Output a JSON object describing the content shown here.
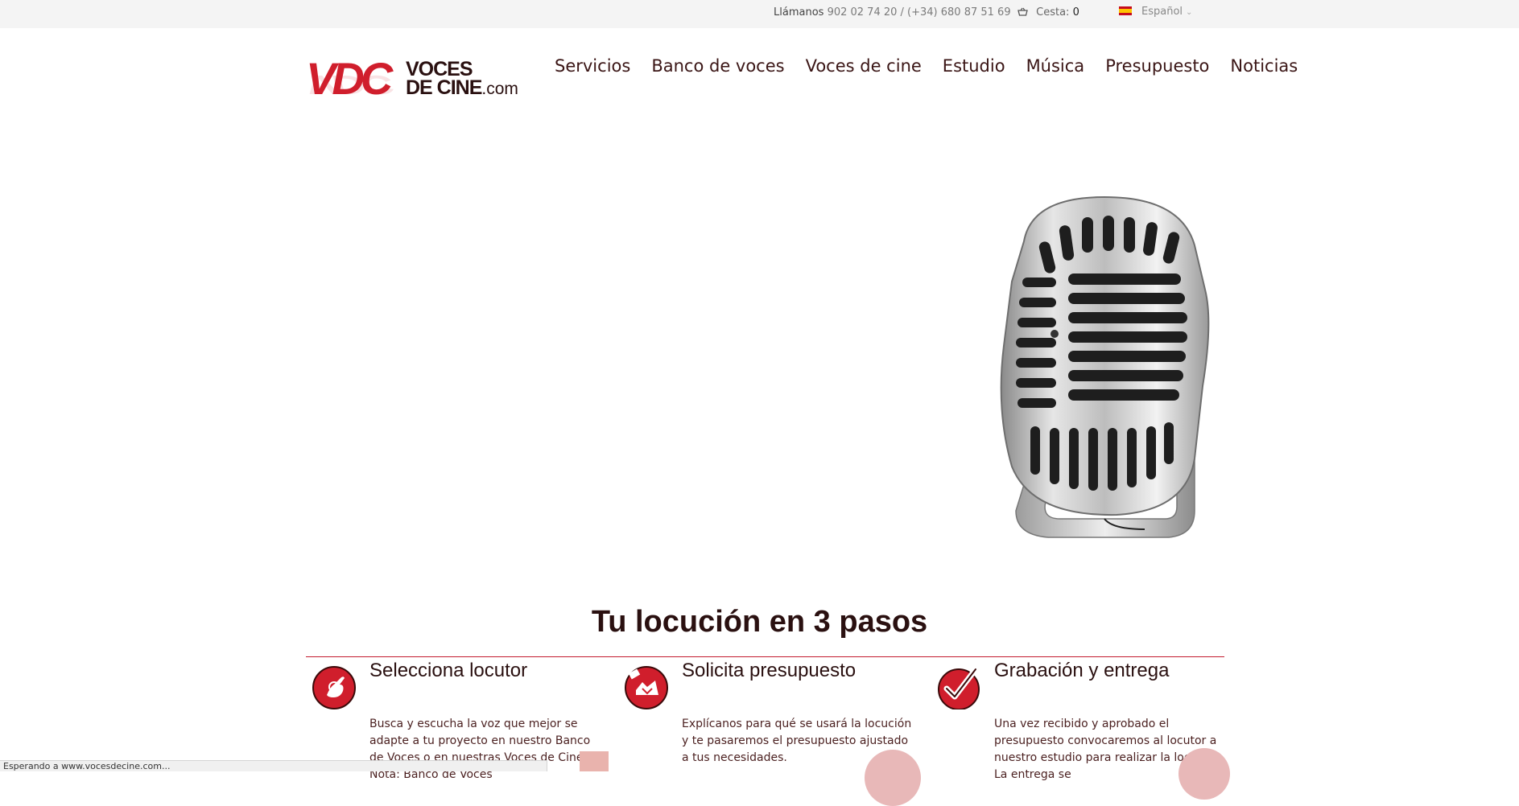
{
  "topbar": {
    "phone_label": "Llámanos",
    "phone_numbers": "902 02 74 20 / (+34) 680 87 51 69",
    "cart_label": "Cesta:",
    "cart_count": "0",
    "language": "Español"
  },
  "logo": {
    "mark": "VDC",
    "line1": "VOCES",
    "line2": "DE CINE",
    "domain": ".com"
  },
  "nav": [
    "Servicios",
    "Banco de voces",
    "Voces de cine",
    "Estudio",
    "Música",
    "Presupuesto",
    "Noticias"
  ],
  "section": {
    "title": "Tu locución en 3 pasos"
  },
  "steps": [
    {
      "title": "Selecciona locutor",
      "text": "Busca y escucha la voz que mejor se adapte a tu proyecto en nuestro Banco de Voces o en nuestras Voces de Cine. Nota: Banco de Voces",
      "icon": "hand-pointer-icon"
    },
    {
      "title": "Solicita presupuesto",
      "text": "Explícanos para qué se usará la locución y te pasaremos el presupuesto ajustado a tus necesidades.",
      "icon": "quote-request-icon"
    },
    {
      "title": "Grabación y entrega",
      "text": "Una vez recibido y aprobado el presupuesto convocaremos al locutor a nuestro estudio para realizar la locución. La entrega se",
      "icon": "checkmark-icon"
    }
  ],
  "status_bar": "Esperando a www.vocesdecine.com...",
  "colors": {
    "brand_red": "#d01e2c",
    "text_dark": "#2a1010",
    "divider": "#c21a2e"
  }
}
